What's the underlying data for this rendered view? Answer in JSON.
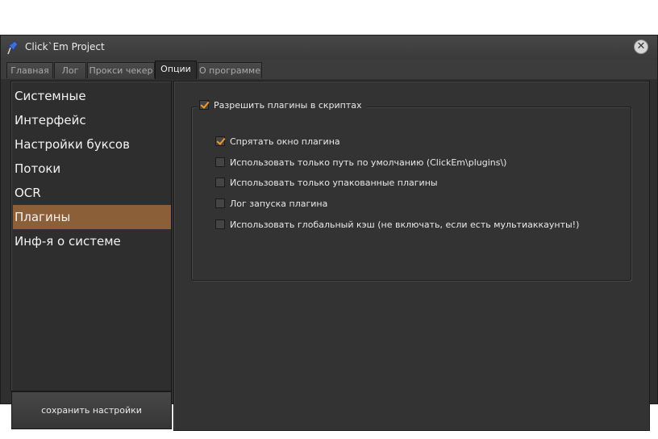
{
  "window": {
    "title": "Click`Em Project",
    "close_symbol": "✕"
  },
  "tabs": [
    {
      "label": "Главная",
      "active": false
    },
    {
      "label": "Лог",
      "active": false
    },
    {
      "label": "Прокси чекер",
      "active": false
    },
    {
      "label": "Опции",
      "active": true
    },
    {
      "label": "О программе",
      "active": false
    }
  ],
  "sidebar": {
    "items": [
      {
        "label": "Системные",
        "selected": false
      },
      {
        "label": "Интерфейс",
        "selected": false
      },
      {
        "label": "Настройки буксов",
        "selected": false
      },
      {
        "label": "Потоки",
        "selected": false
      },
      {
        "label": "OCR",
        "selected": false
      },
      {
        "label": "Плагины",
        "selected": true
      },
      {
        "label": "Инф-я о системе",
        "selected": false
      }
    ],
    "save_label": "сохранить настройки"
  },
  "plugins": {
    "group_label": "Разрешить плагины в скриптах",
    "group_checked": true,
    "options": [
      {
        "label": "Спрятать окно плагина",
        "checked": true
      },
      {
        "label": "Использовать только путь по умолчанию (ClickEm\\plugins\\)",
        "checked": false
      },
      {
        "label": "Использовать только упакованные плагины",
        "checked": false
      },
      {
        "label": "Лог запуска плагина",
        "checked": false
      },
      {
        "label": "Использовать глобальный кэш (не включать, если есть мультиаккаунты!)",
        "checked": false
      }
    ]
  },
  "colors": {
    "accent_selected": "#8b5f38",
    "checkmark": "#f19a2b",
    "background": "#2f2f2f"
  },
  "icons": {
    "app": "pin-icon",
    "close": "close-icon",
    "checkbox": "checkmark-icon"
  }
}
